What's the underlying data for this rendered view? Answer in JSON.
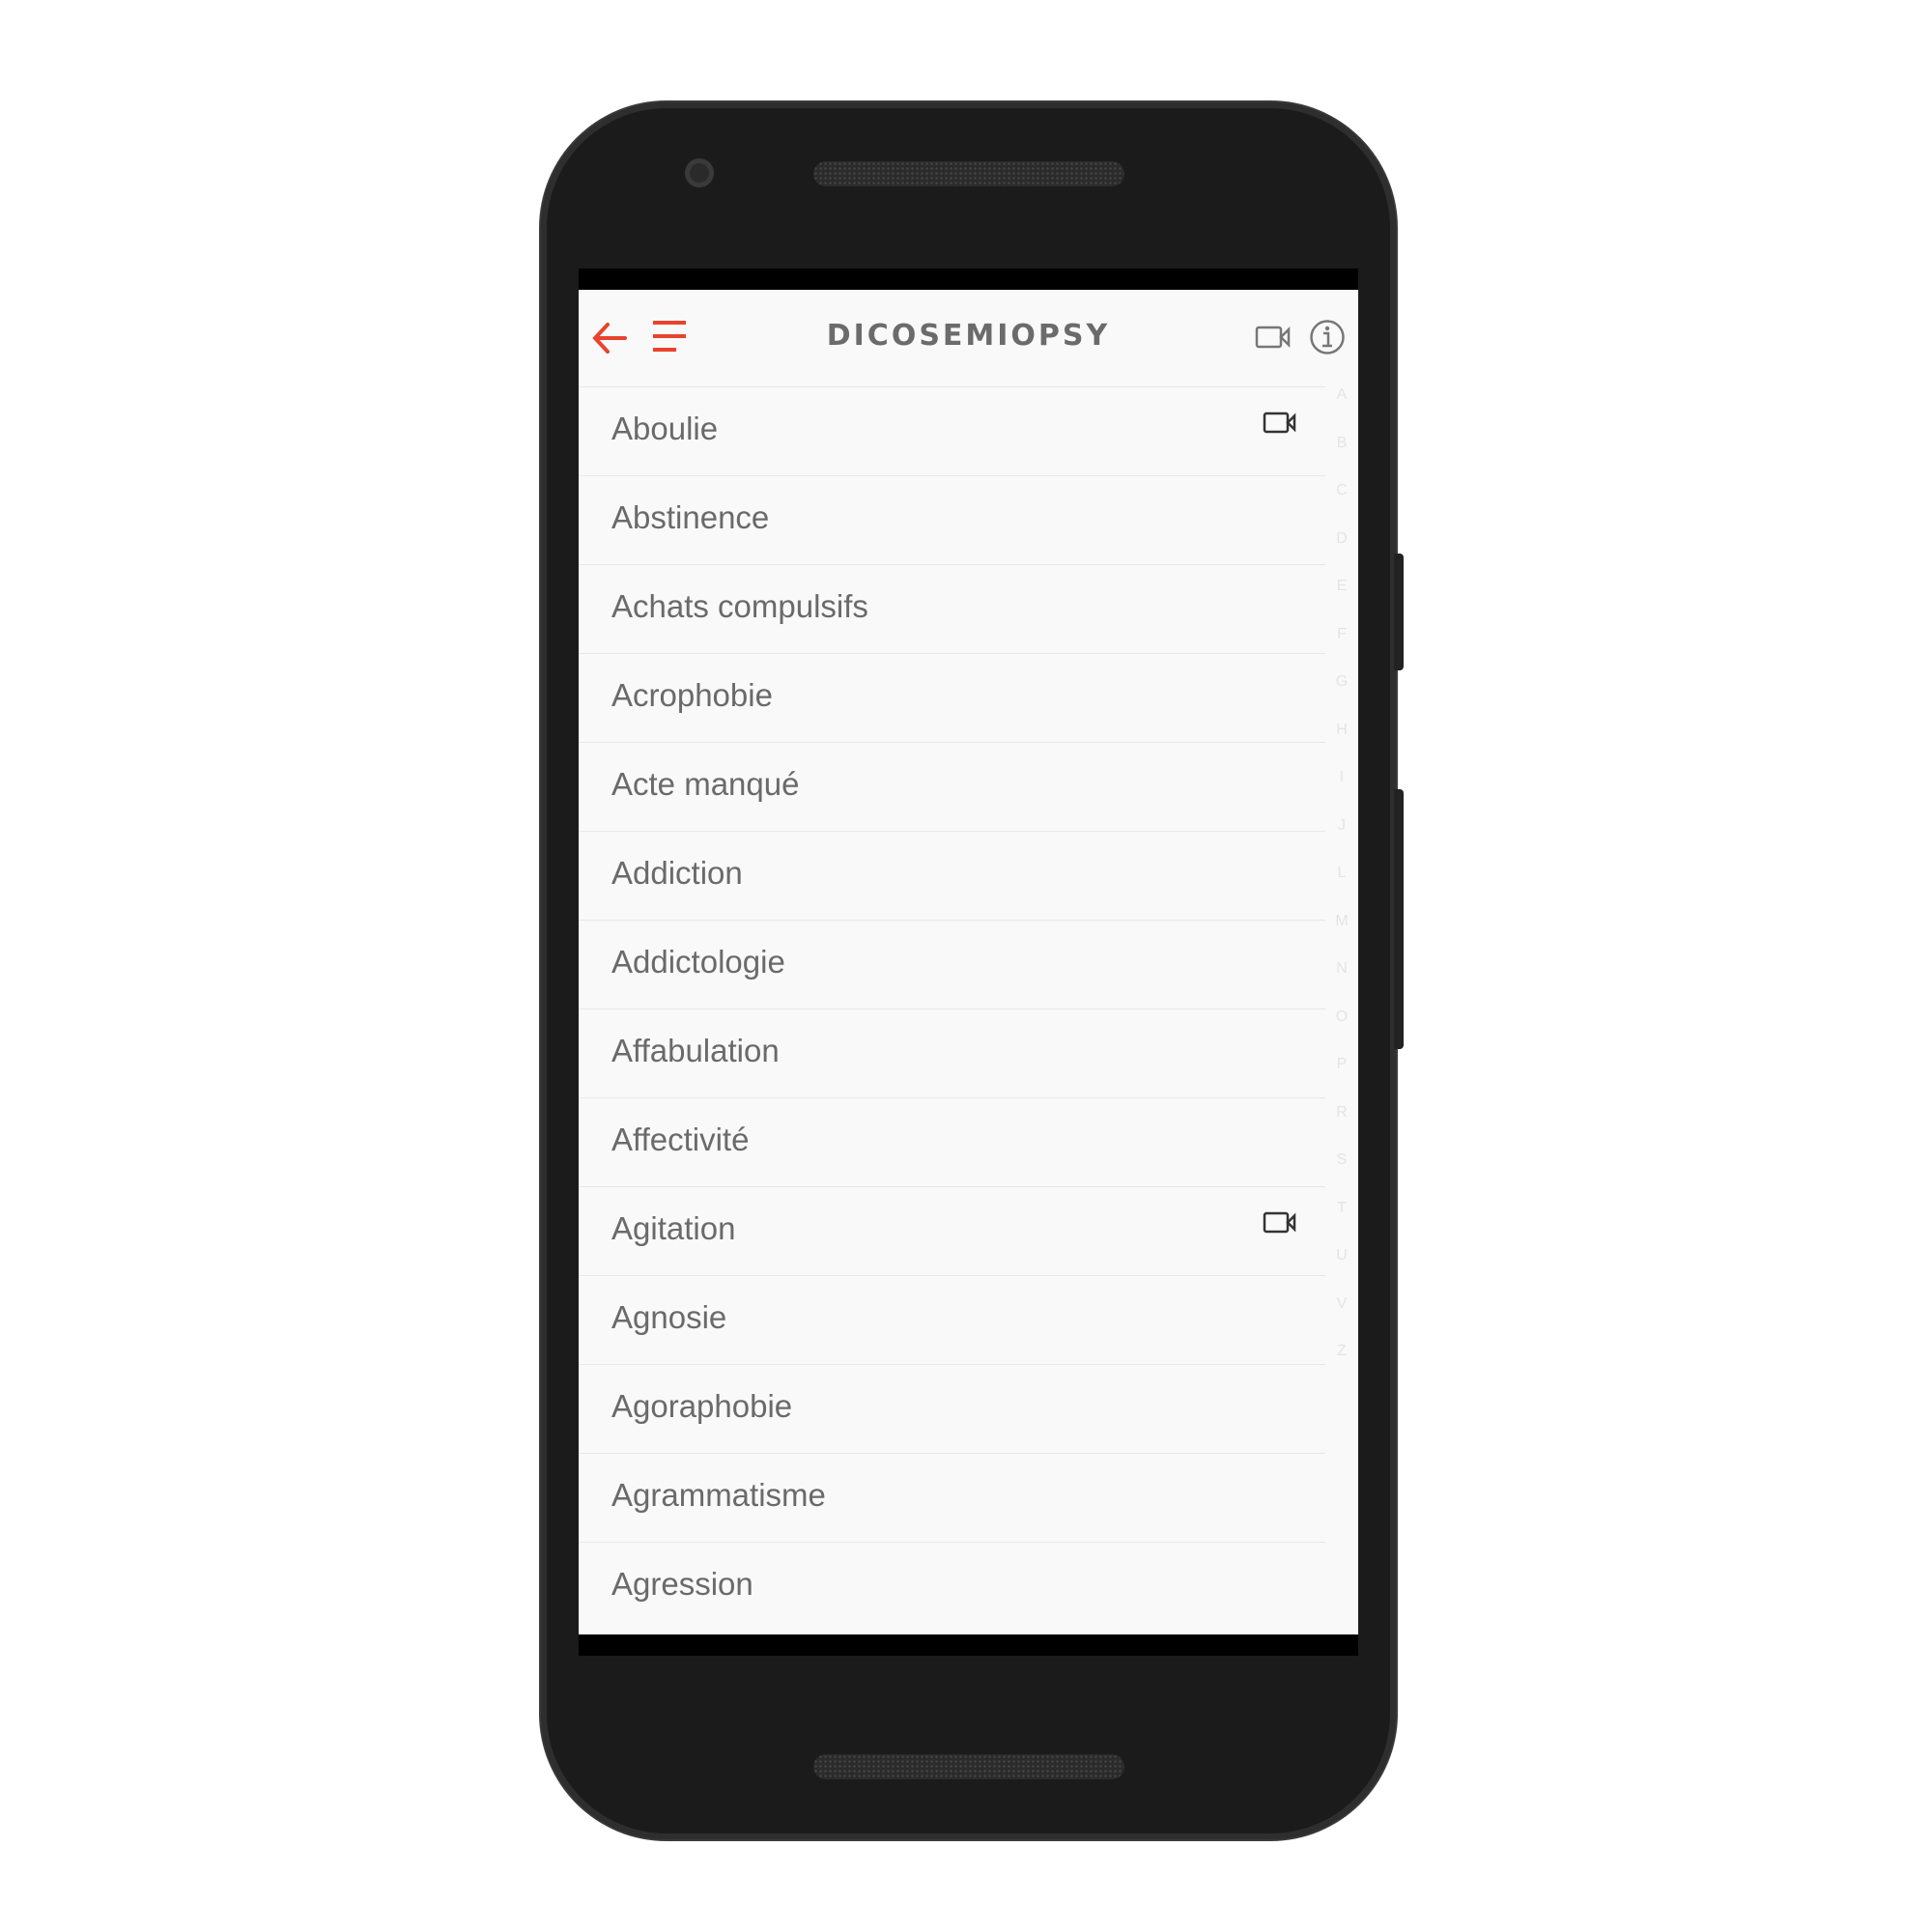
{
  "app": {
    "title": "DICOSEMIOPSY",
    "accent_color": "#e8432e",
    "header": {
      "back_icon": "arrow-left-icon",
      "menu_icon": "menu-icon",
      "video_icon": "video-camera-icon",
      "info_icon": "info-icon"
    },
    "items": [
      {
        "label": "Aboulie",
        "video": true
      },
      {
        "label": "Abstinence",
        "video": false
      },
      {
        "label": "Achats compulsifs",
        "video": false
      },
      {
        "label": "Acrophobie",
        "video": false
      },
      {
        "label": "Acte manqué",
        "video": false
      },
      {
        "label": "Addiction",
        "video": false
      },
      {
        "label": "Addictologie",
        "video": false
      },
      {
        "label": "Affabulation",
        "video": false
      },
      {
        "label": "Affectivité",
        "video": false
      },
      {
        "label": "Agitation",
        "video": true
      },
      {
        "label": "Agnosie",
        "video": false
      },
      {
        "label": "Agoraphobie",
        "video": false
      },
      {
        "label": "Agrammatisme",
        "video": false
      },
      {
        "label": "Agression",
        "video": false
      }
    ],
    "alphabet_index": [
      "A",
      "B",
      "C",
      "D",
      "E",
      "F",
      "G",
      "H",
      "I",
      "J",
      "L",
      "M",
      "N",
      "O",
      "P",
      "R",
      "S",
      "T",
      "U",
      "V",
      "Z"
    ]
  }
}
